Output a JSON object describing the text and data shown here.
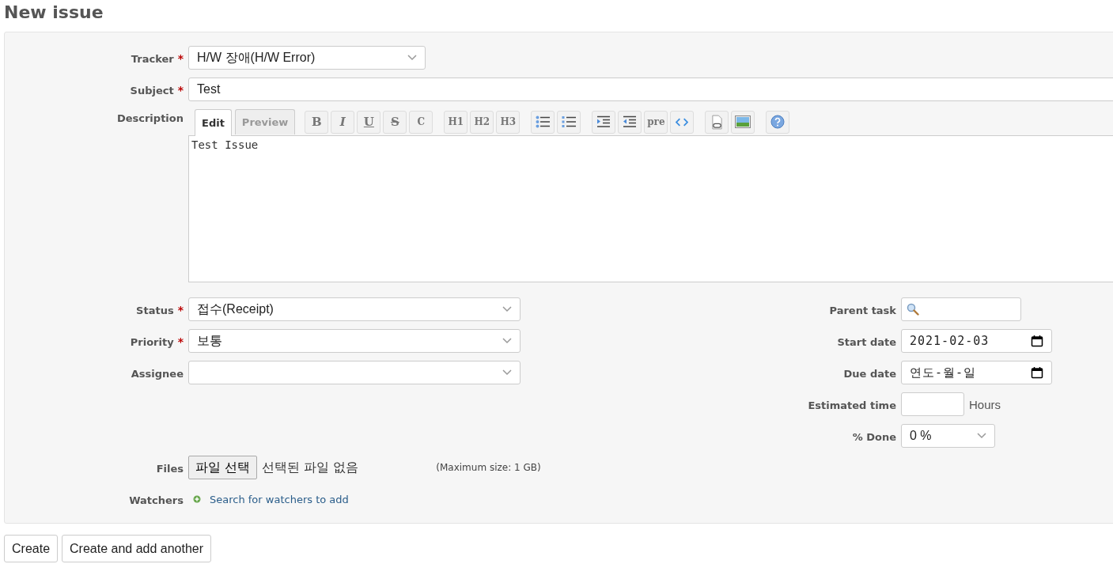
{
  "title": "New issue",
  "top_fields": [
    {
      "label": "Tracker",
      "mark": "*",
      "kind": "select",
      "value": "H/W 장애(H/W Error)"
    },
    {
      "label": "Subject",
      "mark": "*",
      "kind": "text",
      "value": "Test"
    }
  ],
  "description": {
    "label": "Description",
    "tabs": [
      {
        "label": "Edit",
        "selected": true
      },
      {
        "label": "Preview",
        "selected": false
      }
    ],
    "toolbar": [
      [
        {
          "kind": "bold",
          "label": "B"
        },
        {
          "kind": "italic",
          "label": "I"
        },
        {
          "kind": "underline",
          "label": "U"
        },
        {
          "kind": "strike",
          "label": "S"
        },
        {
          "kind": "plain",
          "label": "C"
        }
      ],
      [
        {
          "kind": "plain",
          "label": "H1"
        },
        {
          "kind": "plain",
          "label": "H2"
        },
        {
          "kind": "plain",
          "label": "H3"
        }
      ],
      [
        {
          "kind": "bullets"
        },
        {
          "kind": "numbers"
        }
      ],
      [
        {
          "kind": "indent"
        },
        {
          "kind": "outdent"
        },
        {
          "kind": "plain",
          "label": "pre"
        },
        {
          "kind": "code"
        }
      ],
      [
        {
          "kind": "attach"
        },
        {
          "kind": "image"
        }
      ],
      [
        {
          "kind": "help"
        }
      ]
    ],
    "value": "Test Issue"
  },
  "left_fields": [
    {
      "label": "Status",
      "mark": "*",
      "value": "접수(Receipt)"
    },
    {
      "label": "Priority",
      "mark": "*",
      "value": "보통"
    },
    {
      "label": "Assignee"
    }
  ],
  "right_fields": [
    {
      "label": "Parent task",
      "kind": "search"
    },
    {
      "label": "Start date",
      "kind": "date",
      "value": "2021-02-03"
    },
    {
      "label": "Due date",
      "kind": "date",
      "placeholder": "연도-월-일"
    },
    {
      "label": "Estimated time",
      "kind": "number",
      "unit": "Hours"
    },
    {
      "label": "% Done",
      "kind": "select",
      "value": "0 %"
    }
  ],
  "files": {
    "label": "Files",
    "button": "파일 선택",
    "status": "선택된 파일 없음",
    "note": "(Maximum size: 1 GB)"
  },
  "watchers": {
    "label": "Watchers",
    "link": "Search for watchers to add"
  },
  "buttons": [
    "Create",
    "Create and add another"
  ]
}
